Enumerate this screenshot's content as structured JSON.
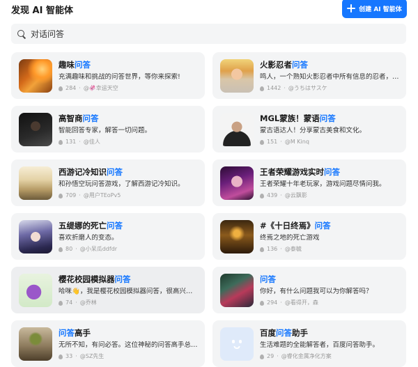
{
  "header": {
    "title": "发现 AI 智能体",
    "create_button": "创建 AI 智能体"
  },
  "search": {
    "value": "",
    "placeholder": "对话问答"
  },
  "icons": {
    "search": "search-icon",
    "create": "plus-icon",
    "popularity": "fire-icon"
  },
  "colors": {
    "accent": "#1677ff",
    "card_bg": "#f3f4f5"
  },
  "cards": [
    {
      "title_pre": "趣味",
      "title_kw": "问答",
      "title_post": "",
      "desc": "充满趣味和挑战的问答世界，等你来探索!",
      "count": "284",
      "author": "@🦑幸运天空",
      "avatar": "autumn-leaves-avatar"
    },
    {
      "title_pre": "火影忍者",
      "title_kw": "问答",
      "title_post": "",
      "desc": "鸣人，一个熟知火影忍者中所有信息的忍者，能...",
      "count": "1442",
      "author": "@うちはサスケ",
      "avatar": "naruto-avatar"
    },
    {
      "title_pre": "高智商",
      "title_kw": "问答",
      "title_post": "",
      "desc": "智能回答专家，解答一切问题。",
      "count": "131",
      "author": "@佳人",
      "avatar": "man-portrait-avatar"
    },
    {
      "title_pre": "MGL蒙族！蒙语",
      "title_kw": "问答",
      "title_post": "",
      "desc": "蒙古语达人！分享蒙古美食和文化。",
      "count": "151",
      "author": "@M Kinq",
      "avatar": "man-photo-avatar"
    },
    {
      "title_pre": "西游记冷知识",
      "title_kw": "问答",
      "title_post": "",
      "desc": "和孙悟空玩问答游戏，了解西游记冷知识。",
      "count": "709",
      "author": "@用户TEoPv5",
      "avatar": "journey-west-avatar"
    },
    {
      "title_pre": "王者荣耀游戏实时",
      "title_kw": "问答",
      "title_post": "",
      "desc": "王者荣耀十年老玩家，游戏问题尽情问我。",
      "count": "439",
      "author": "@云飘影",
      "avatar": "game-hero-avatar"
    },
    {
      "title_pre": "五缇娜的死亡",
      "title_kw": "问答",
      "title_post": "",
      "desc": "喜欢折磨人的变态。",
      "count": "80",
      "author": "@小呆瓜ddfdr",
      "avatar": "anime-girl-avatar"
    },
    {
      "title_pre": "#《十日终焉》",
      "title_kw": "问答",
      "title_post": "",
      "desc": "终焉之地的死亡游戏",
      "count": "136",
      "author": "@泰毓",
      "avatar": "book-cover-avatar"
    },
    {
      "title_pre": "樱花校园模拟器",
      "title_kw": "问答",
      "title_post": "",
      "desc": "哈咪👋，我是樱花校园模拟器问答，很高兴认...",
      "count": "74",
      "author": "@乔林",
      "avatar": "clay-figure-avatar"
    },
    {
      "title_pre": "",
      "title_kw": "问答",
      "title_post": "",
      "desc": "你好，有什么问题我可以为你解答吗？",
      "count": "294",
      "author": "@看得开，森",
      "avatar": "phone-screen-avatar"
    },
    {
      "title_pre": "",
      "title_kw": "问答",
      "title_post": "高手",
      "desc": "无所不知，有问必答。这位神秘的问答高手总能...",
      "count": "33",
      "author": "@SZ先生",
      "avatar": "plant-avatar"
    },
    {
      "title_pre": "百度",
      "title_kw": "问答",
      "title_post": "助手",
      "desc": "生活难题的全能解答者，百度问答助手。",
      "count": "29",
      "author": "@睿化金属净化方案",
      "avatar": "robot-face-avatar"
    }
  ]
}
